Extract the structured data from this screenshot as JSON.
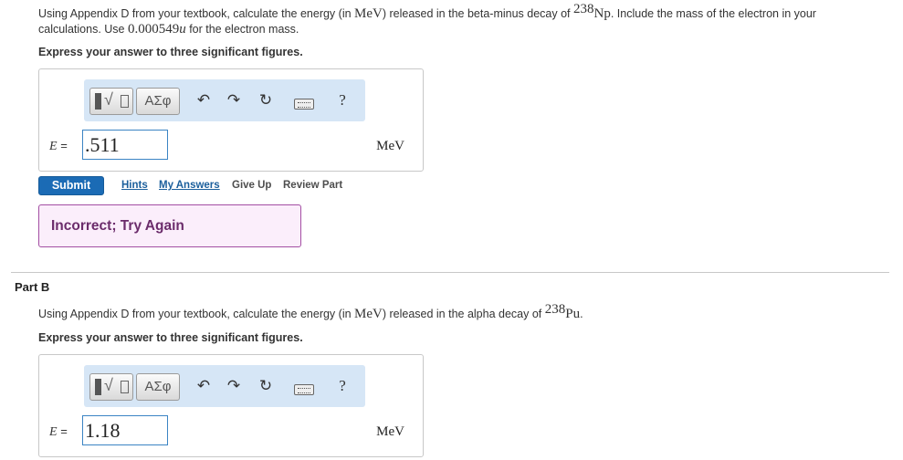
{
  "part_a": {
    "question_line1_pre": "Using Appendix D from your textbook, calculate the energy (in ",
    "unit_mev": "MeV",
    "question_line1_mid": ") released in the beta-minus decay of ",
    "isotope_mass": "238",
    "isotope_symbol": "Np",
    "question_line1_post": ". Include the mass of the electron in your",
    "question_line2_pre": "calculations. Use ",
    "electron_mass": "0.000549",
    "electron_mass_unit": "u",
    "question_line2_post": " for the electron mass.",
    "instruction": "Express your answer to three significant figures.",
    "variable": "E",
    "equals": "=",
    "answer_value": ".511",
    "answer_unit": "MeV",
    "submit_label": "Submit",
    "hints_label": "Hints",
    "my_answers_label": "My Answers",
    "give_up_label": "Give Up",
    "review_part_label": "Review Part",
    "feedback": "Incorrect; Try Again"
  },
  "part_b": {
    "title": "Part B",
    "question_pre": "Using Appendix D from your textbook, calculate the energy (in ",
    "unit_mev": "MeV",
    "question_mid": ") released in the alpha decay of ",
    "isotope_mass": "238",
    "isotope_symbol": "Pu",
    "question_post": ".",
    "instruction": "Express your answer to three significant figures.",
    "variable": "E",
    "equals": "=",
    "answer_value": "1.18",
    "answer_unit": "MeV"
  },
  "toolbar": {
    "greek_label": "ΑΣφ",
    "undo_glyph": "↶",
    "redo_glyph": "↷",
    "reset_glyph": "↻",
    "help_glyph": "?",
    "icons": [
      "templates-icon",
      "greek-letters-icon",
      "undo-icon",
      "redo-icon",
      "reset-icon",
      "keyboard-icon",
      "help-icon"
    ]
  },
  "colors": {
    "submit": "#1b6bb5",
    "toolbar_bg": "#d6e6f6",
    "feedback_border": "#a34ea3",
    "feedback_bg": "#fbeefb",
    "link": "#1b5f9c"
  }
}
